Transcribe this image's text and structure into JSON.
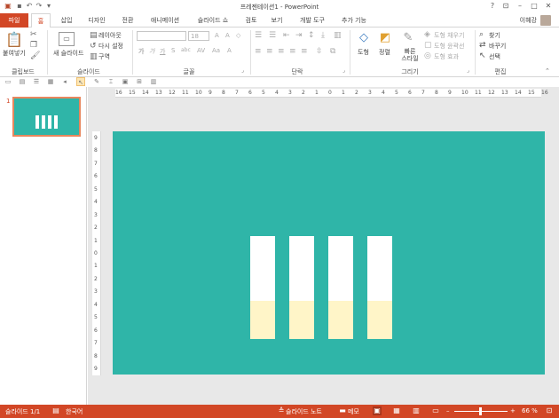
{
  "window": {
    "title": "프레젠테이션1 - PowerPoint",
    "user_name": "이혜강",
    "help": "?",
    "minimize": "–",
    "restore": "□",
    "close": "✕"
  },
  "tabs": [
    {
      "label": "파일"
    },
    {
      "label": "홈"
    },
    {
      "label": "삽입"
    },
    {
      "label": "디자인"
    },
    {
      "label": "전환"
    },
    {
      "label": "애니메이션"
    },
    {
      "label": "슬라이드 쇼"
    },
    {
      "label": "검토"
    },
    {
      "label": "보기"
    },
    {
      "label": "개발 도구"
    },
    {
      "label": "추가 기능"
    }
  ],
  "ribbon": {
    "clipboard": {
      "paste_label": "붙여넣기",
      "group_label": "클립보드"
    },
    "slides": {
      "new_slide_label": "새 슬라이드",
      "layout_label": "레이아웃",
      "reset_label": "다시 설정",
      "section_label": "구역",
      "group_label": "슬라이드"
    },
    "font": {
      "font_size": "18",
      "group_label": "글꼴",
      "bold": "가",
      "italic": "가",
      "underline": "가",
      "strike": "S",
      "shadow": "abc",
      "spacing": "AV",
      "case": "Aa",
      "clear": "A"
    },
    "paragraph": {
      "group_label": "단락"
    },
    "drawing": {
      "shapes_label": "도형",
      "arrange_label": "정렬",
      "quick_styles_label": "빠른 스타일",
      "fill_label": "도형 채우기",
      "outline_label": "도형 윤곽선",
      "effects_label": "도형 효과",
      "group_label": "그리기"
    },
    "editing": {
      "find_label": "찾기",
      "replace_label": "바꾸기",
      "select_label": "선택",
      "group_label": "편집"
    }
  },
  "rulers": {
    "horizontal": [
      "16",
      "15",
      "14",
      "13",
      "12",
      "11",
      "10",
      "9",
      "8",
      "7",
      "6",
      "5",
      "4",
      "3",
      "2",
      "1",
      "0",
      "1",
      "2",
      "3",
      "4",
      "5",
      "6",
      "7",
      "8",
      "9",
      "10",
      "11",
      "12",
      "13",
      "14",
      "15",
      "16"
    ],
    "vertical": [
      "9",
      "8",
      "7",
      "6",
      "5",
      "4",
      "3",
      "2",
      "1",
      "0",
      "1",
      "2",
      "3",
      "4",
      "5",
      "6",
      "7",
      "8",
      "9"
    ]
  },
  "thumbnail": {
    "number": "1"
  },
  "slide": {
    "background_color": "#2fb5a8",
    "bars": [
      {
        "fill_fraction": 0.37
      },
      {
        "fill_fraction": 0.37
      },
      {
        "fill_fraction": 0.37
      },
      {
        "fill_fraction": 0.37
      }
    ]
  },
  "status": {
    "slide_count": "슬라이드 1/1",
    "language": "한국어",
    "notes_label": "슬라이드 노트",
    "comments_label": "메모",
    "zoom": "66 %",
    "zoom_minus": "–",
    "zoom_plus": "+"
  },
  "colors": {
    "accent": "#d24726",
    "slide": "#2fb5a8",
    "bar_fill": "#fff5c8"
  }
}
